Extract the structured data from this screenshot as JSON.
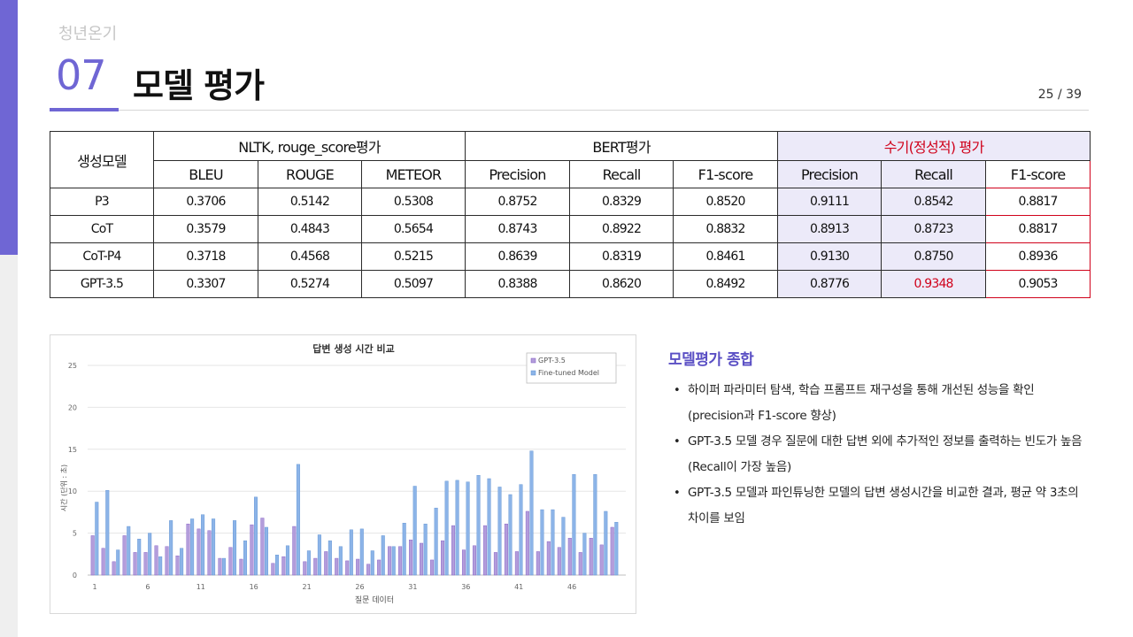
{
  "header": {
    "brand": "청년온기",
    "section_number": "07",
    "section_title": "모델 평가",
    "page_indicator": "25 / 39"
  },
  "table": {
    "model_header": "생성모델",
    "groups": [
      "NLTK, rouge_score평가",
      "BERT평가",
      "수기(정성적) 평가"
    ],
    "metric_headers": [
      "BLEU",
      "ROUGE",
      "METEOR",
      "Precision",
      "Recall",
      "F1-score",
      "Precision",
      "Recall",
      "F1-score"
    ],
    "rows": [
      {
        "model": "P3",
        "values": [
          "0.3706",
          "0.5142",
          "0.5308",
          "0.8752",
          "0.8329",
          "0.8520",
          "0.9111",
          "0.8542",
          "0.8817"
        ]
      },
      {
        "model": "CoT",
        "values": [
          "0.3579",
          "0.4843",
          "0.5654",
          "0.8743",
          "0.8922",
          "0.8832",
          "0.8913",
          "0.8723",
          "0.8817"
        ]
      },
      {
        "model": "CoT-P4",
        "values": [
          "0.3718",
          "0.4568",
          "0.5215",
          "0.8639",
          "0.8319",
          "0.8461",
          "0.9130",
          "0.8750",
          "0.8936"
        ]
      },
      {
        "model": "GPT-3.5",
        "values": [
          "0.3307",
          "0.5274",
          "0.5097",
          "0.8388",
          "0.8620",
          "0.8492",
          "0.8776",
          "0.9348",
          "0.9053"
        ]
      }
    ],
    "highlight_color": "#d0021b",
    "manual_bg": "#eceaf9"
  },
  "chart_data": {
    "type": "bar",
    "title": "답변 생성 시간 비교",
    "xlabel": "질문 데이터",
    "ylabel": "시간 (단위 : 초)",
    "ylim": [
      0,
      25
    ],
    "yticks": [
      0,
      5,
      10,
      15,
      20,
      25
    ],
    "xtick_labels": [
      "1",
      "6",
      "11",
      "16",
      "21",
      "26",
      "31",
      "36",
      "41",
      "46"
    ],
    "legend_position": "top-right",
    "x": [
      1,
      2,
      3,
      4,
      5,
      6,
      7,
      8,
      9,
      10,
      11,
      12,
      13,
      14,
      15,
      16,
      17,
      18,
      19,
      20,
      21,
      22,
      23,
      24,
      25,
      26,
      27,
      28,
      29,
      30,
      31,
      32,
      33,
      34,
      35,
      36,
      37,
      38,
      39,
      40,
      41,
      42,
      43,
      44,
      45,
      46,
      47,
      48,
      49,
      50
    ],
    "series": [
      {
        "name": "GPT-3.5",
        "color": "#b39ddb",
        "values": [
          4.7,
          3.2,
          1.6,
          4.7,
          2.7,
          2.7,
          3.5,
          3.4,
          2.3,
          6.1,
          5.5,
          5.3,
          2.0,
          3.3,
          1.9,
          6.0,
          6.8,
          1.4,
          2.2,
          5.8,
          1.6,
          2.0,
          2.8,
          2.0,
          1.7,
          1.9,
          1.3,
          1.8,
          3.4,
          3.4,
          4.2,
          3.8,
          1.8,
          4.1,
          5.9,
          3.0,
          3.5,
          5.9,
          2.7,
          6.1,
          2.8,
          7.6,
          2.8,
          4.0,
          3.3,
          4.4,
          2.7,
          4.4,
          3.6,
          5.7
        ]
      },
      {
        "name": "Fine-tuned Model",
        "color": "#8cb4e8",
        "values": [
          8.7,
          10.1,
          3.0,
          5.8,
          4.3,
          5.0,
          2.2,
          6.5,
          3.2,
          6.7,
          7.2,
          6.7,
          2.0,
          6.5,
          4.1,
          9.3,
          5.7,
          2.4,
          3.5,
          13.2,
          2.9,
          4.8,
          4.1,
          3.4,
          5.4,
          5.5,
          2.9,
          4.7,
          3.4,
          6.2,
          10.6,
          6.1,
          8.0,
          11.2,
          11.3,
          11.1,
          11.9,
          11.5,
          10.5,
          9.6,
          10.8,
          14.8,
          7.8,
          7.8,
          6.9,
          12.0,
          5.0,
          12.0,
          7.6,
          6.3
        ]
      }
    ]
  },
  "summary": {
    "title": "모델평가 종합",
    "bullets": [
      "하이퍼 파라미터 탐색, 학습 프롬프트 재구성을 통해 개선된 성능을 확인 (precision과 F1-score 향상)",
      "GPT-3.5 모델 경우 질문에 대한 답변 외에 추가적인 정보를 출력하는 빈도가 높음 (Recall이 가장 높음)",
      "GPT-3.5 모델과 파인튜닝한 모델의 답변 생성시간을 비교한 결과, 평균 약 3초의 차이를 보임"
    ]
  }
}
